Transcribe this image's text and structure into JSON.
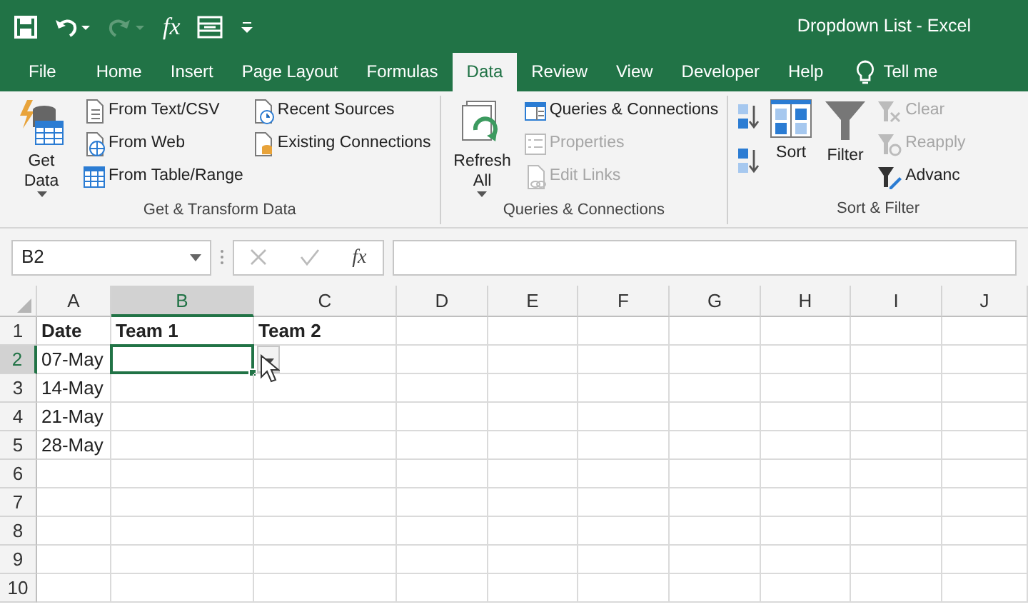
{
  "window": {
    "title": "Dropdown List  -  Excel"
  },
  "quick_access": {
    "function_label": "fx",
    "redo_disabled": true
  },
  "tabs": [
    {
      "label": "File",
      "selected": false
    },
    {
      "label": "Home",
      "selected": false
    },
    {
      "label": "Insert",
      "selected": false
    },
    {
      "label": "Page Layout",
      "selected": false
    },
    {
      "label": "Formulas",
      "selected": false
    },
    {
      "label": "Data",
      "selected": true
    },
    {
      "label": "Review",
      "selected": false
    },
    {
      "label": "View",
      "selected": false
    },
    {
      "label": "Developer",
      "selected": false
    },
    {
      "label": "Help",
      "selected": false
    }
  ],
  "tell_me": "Tell me",
  "ribbon_groups": [
    {
      "label": "Get & Transform Data",
      "columns": [
        [
          {
            "kind": "large",
            "label": "Get Data",
            "caret": true,
            "disabled": false
          }
        ],
        [
          {
            "kind": "small",
            "label": "From Text/CSV",
            "disabled": false
          },
          {
            "kind": "small",
            "label": "From Web",
            "disabled": false
          },
          {
            "kind": "small",
            "label": "From Table/Range",
            "disabled": false
          }
        ],
        [
          {
            "kind": "small",
            "label": "Recent Sources",
            "disabled": false
          },
          {
            "kind": "small",
            "label": "Existing Connections",
            "disabled": false
          }
        ]
      ]
    },
    {
      "label": "Queries & Connections",
      "columns": [
        [
          {
            "kind": "large",
            "label": "Refresh All",
            "caret": true,
            "disabled": false
          }
        ],
        [
          {
            "kind": "small",
            "label": "Queries & Connections",
            "disabled": false
          },
          {
            "kind": "small",
            "label": "Properties",
            "disabled": true
          },
          {
            "kind": "small",
            "label": "Edit Links",
            "disabled": true
          }
        ]
      ]
    },
    {
      "label": "Sort & Filter",
      "columns": [
        [
          {
            "kind": "icon",
            "disabled": false
          },
          {
            "kind": "icon",
            "disabled": false
          }
        ],
        [
          {
            "kind": "large",
            "label": "Sort",
            "caret": false,
            "disabled": false
          }
        ],
        [
          {
            "kind": "large",
            "label": "Filter",
            "caret": false,
            "disabled": false
          }
        ],
        [
          {
            "kind": "small",
            "label": "Clear",
            "disabled": true
          },
          {
            "kind": "small",
            "label": "Reapply",
            "disabled": true
          },
          {
            "kind": "small",
            "label": "Advanc",
            "disabled": false
          }
        ]
      ]
    }
  ],
  "formula_bar": {
    "name_box": "B2",
    "function_label": "fx"
  },
  "sheet": {
    "columns": [
      {
        "label": "A",
        "selected": false
      },
      {
        "label": "B",
        "selected": true
      },
      {
        "label": "C",
        "selected": false
      },
      {
        "label": "D",
        "selected": false
      },
      {
        "label": "E",
        "selected": false
      },
      {
        "label": "F",
        "selected": false
      },
      {
        "label": "G",
        "selected": false
      },
      {
        "label": "H",
        "selected": false
      },
      {
        "label": "I",
        "selected": false
      },
      {
        "label": "J",
        "selected": false
      }
    ],
    "validation_dropdown": true,
    "rows": [
      {
        "number": "1",
        "selected": false,
        "cells": [
          {
            "text": "Date",
            "bold": true
          },
          {
            "text": "Team 1",
            "bold": true
          },
          {
            "text": "Team 2",
            "bold": true
          }
        ]
      },
      {
        "number": "2",
        "selected": true,
        "cells": [
          {
            "text": "07-May",
            "bold": false
          }
        ]
      },
      {
        "number": "3",
        "selected": false,
        "cells": [
          {
            "text": "14-May",
            "bold": false
          }
        ]
      },
      {
        "number": "4",
        "selected": false,
        "cells": [
          {
            "text": "21-May",
            "bold": false
          }
        ]
      },
      {
        "number": "5",
        "selected": false,
        "cells": [
          {
            "text": "28-May",
            "bold": false
          }
        ]
      },
      {
        "number": "6",
        "selected": false
      },
      {
        "number": "7",
        "selected": false
      },
      {
        "number": "8",
        "selected": false
      },
      {
        "number": "9",
        "selected": false
      },
      {
        "number": "10",
        "selected": false
      }
    ]
  }
}
